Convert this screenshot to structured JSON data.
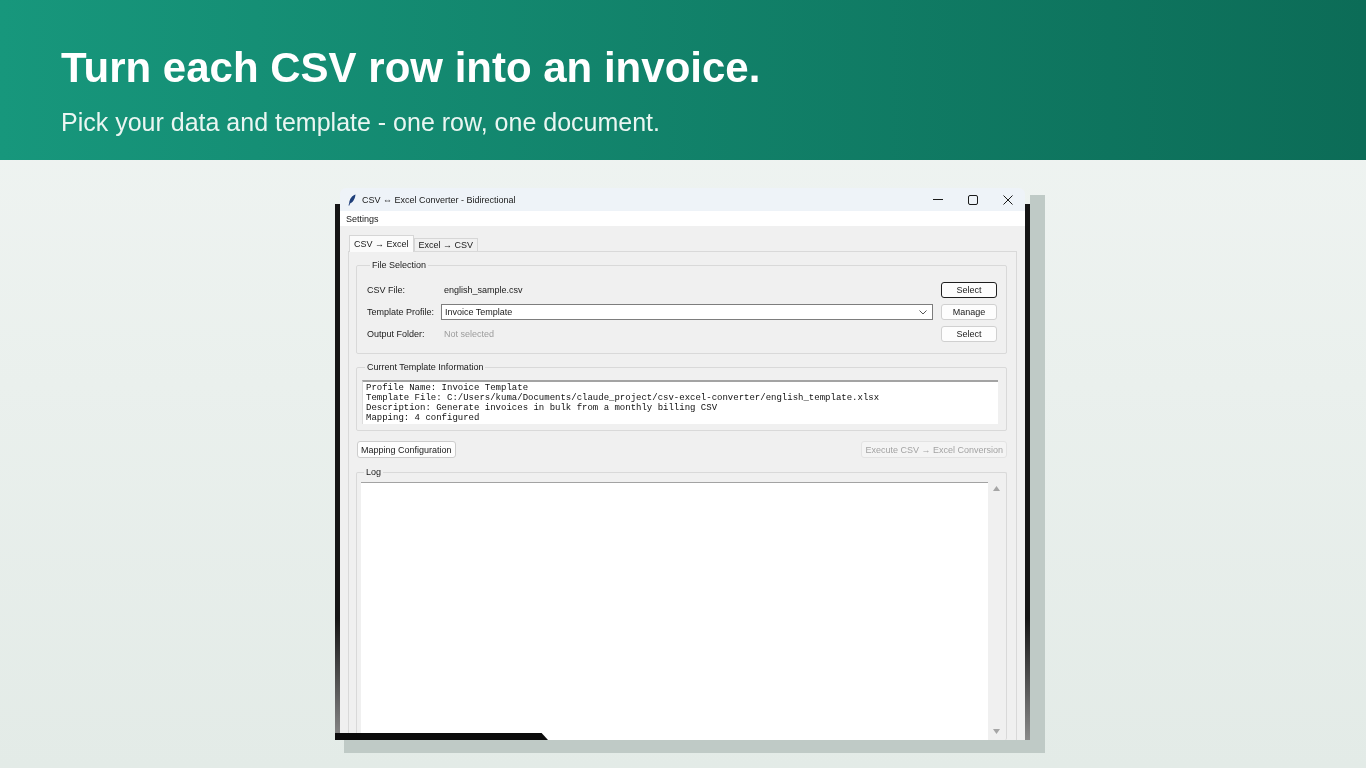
{
  "banner": {
    "title": "Turn each CSV row into an invoice.",
    "subtitle": "Pick your data and template - one row, one document."
  },
  "window": {
    "title": "CSV ⇔ Excel Converter - Bidirectional"
  },
  "menu": [
    {
      "label": "Settings"
    }
  ],
  "tabs": [
    {
      "label": "CSV → Excel",
      "selected": true
    },
    {
      "label": "Excel → CSV",
      "selected": false
    }
  ],
  "file_selection": {
    "title": "File Selection",
    "rows": [
      {
        "kind": "text",
        "label": "CSV File:",
        "value": "english_sample.csv",
        "muted": false,
        "button": {
          "label": "Select",
          "focused": true
        }
      },
      {
        "kind": "combo",
        "label": "Template Profile:",
        "value": "Invoice Template",
        "muted": false,
        "button": {
          "label": "Manage",
          "focused": false
        }
      },
      {
        "kind": "text",
        "label": "Output Folder:",
        "value": "Not selected",
        "muted": true,
        "button": {
          "label": "Select",
          "focused": false
        }
      }
    ]
  },
  "template_info": {
    "title": "Current Template Information",
    "lines": [
      "Profile Name: Invoice Template",
      "Template File: C:/Users/kuma/Documents/claude_project/csv-excel-converter/english_template.xlsx",
      "Description: Generate invoices in bulk from a monthly billing CSV",
      "Mapping: 4 configured"
    ]
  },
  "actions": [
    {
      "label": "Mapping Configuration",
      "disabled": false
    },
    {
      "label": "Execute CSV → Excel Conversion",
      "disabled": true
    }
  ],
  "log": {
    "title": "Log"
  }
}
